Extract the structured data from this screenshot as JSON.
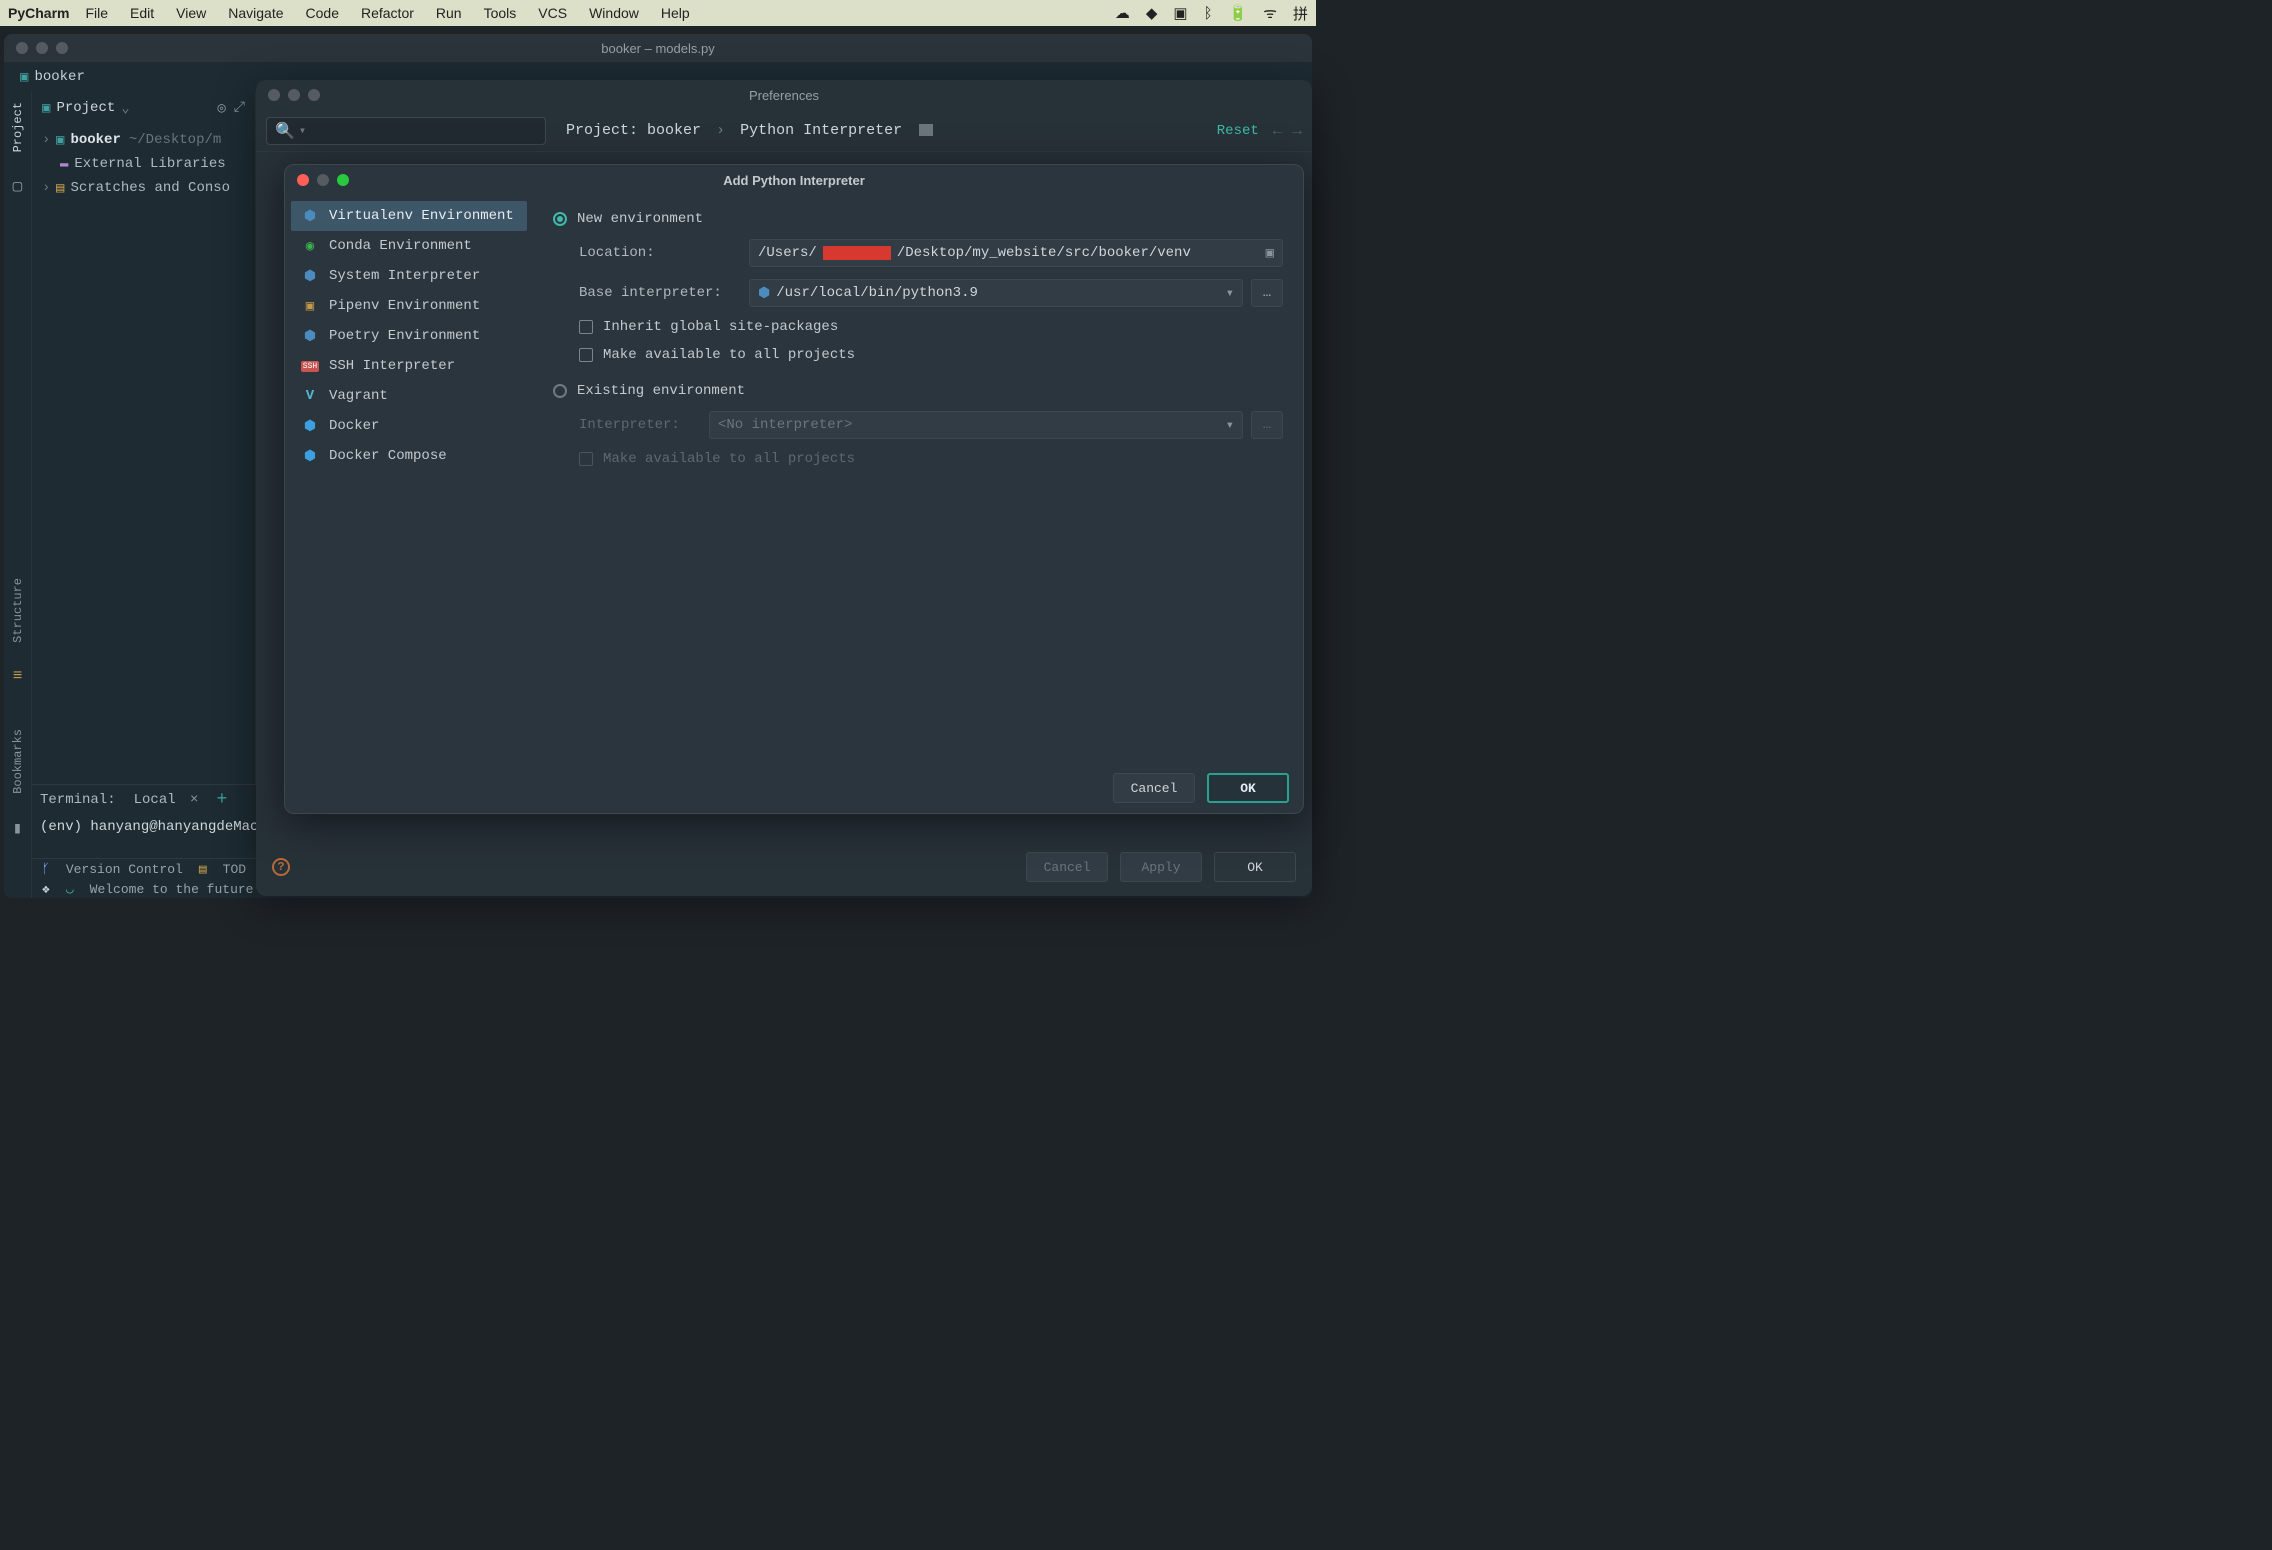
{
  "menubar": {
    "app": "PyCharm",
    "items": [
      "File",
      "Edit",
      "View",
      "Navigate",
      "Code",
      "Refactor",
      "Run",
      "Tools",
      "VCS",
      "Window",
      "Help"
    ],
    "status_icons": [
      "wechat",
      "paper",
      "display",
      "bluetooth",
      "battery",
      "wifi",
      "pinyin"
    ]
  },
  "main_window": {
    "title": "booker – models.py",
    "breadcrumb": "booker"
  },
  "tool_stripe": {
    "project": "Project",
    "structure": "Structure",
    "bookmarks": "Bookmarks"
  },
  "project_panel": {
    "title": "Project",
    "tree": {
      "root": "booker",
      "root_path": "~/Desktop/m",
      "ext_lib": "External Libraries",
      "scratches": "Scratches and Conso"
    }
  },
  "terminal": {
    "label": "Terminal:",
    "tab": "Local",
    "prompt": "(env) hanyang@hanyangdeMacB"
  },
  "status": {
    "version_control": "Version Control",
    "todo": "TOD",
    "welcome": "Welcome to the future of"
  },
  "preferences": {
    "title": "Preferences",
    "search_placeholder": "",
    "breadcrumb_project_prefix": "Project: ",
    "breadcrumb_project": "booker",
    "breadcrumb_page": "Python Interpreter",
    "reset": "Reset",
    "cancel": "Cancel",
    "apply": "Apply",
    "ok": "OK"
  },
  "interp_modal": {
    "title": "Add Python Interpreter",
    "sidebar": [
      {
        "label": "Virtualenv Environment",
        "icon": "python",
        "selected": true
      },
      {
        "label": "Conda Environment",
        "icon": "conda"
      },
      {
        "label": "System Interpreter",
        "icon": "python"
      },
      {
        "label": "Pipenv Environment",
        "icon": "folder"
      },
      {
        "label": "Poetry Environment",
        "icon": "poetry"
      },
      {
        "label": "SSH Interpreter",
        "icon": "ssh"
      },
      {
        "label": "Vagrant",
        "icon": "vagrant"
      },
      {
        "label": "Docker",
        "icon": "docker"
      },
      {
        "label": "Docker Compose",
        "icon": "docker"
      }
    ],
    "new_env": "New environment",
    "location_label": "Location:",
    "location_prefix": "/Users/",
    "location_suffix": "/Desktop/my_website/src/booker/venv",
    "base_label": "Base interpreter:",
    "base_value": "/usr/local/bin/python3.9",
    "inherit": "Inherit global site-packages",
    "make_avail": "Make available to all projects",
    "existing": "Existing environment",
    "interp_label": "Interpreter:",
    "interp_value": "<No interpreter>",
    "make_avail2": "Make available to all projects",
    "cancel": "Cancel",
    "ok": "OK"
  }
}
